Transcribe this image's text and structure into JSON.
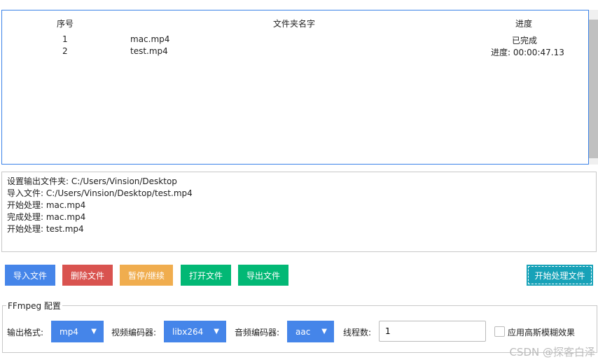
{
  "table": {
    "headers": [
      "序号",
      "文件夹名字",
      "进度"
    ],
    "rows": [
      {
        "index": "1",
        "name": "mac.mp4",
        "progress": "已完成"
      },
      {
        "index": "2",
        "name": "test.mp4",
        "progress": "进度: 00:00:47.13"
      }
    ]
  },
  "log": [
    "设置输出文件夹: C:/Users/Vinsion/Desktop",
    "导入文件: C:/Users/Vinsion/Desktop/test.mp4",
    "开始处理: mac.mp4",
    "完成处理: mac.mp4",
    "开始处理: test.mp4"
  ],
  "buttons": {
    "import": "导入文件",
    "delete": "删除文件",
    "pause": "暂停/继续",
    "open": "打开文件",
    "export": "导出文件",
    "start": "开始处理文件"
  },
  "config": {
    "title": "FFmpeg 配置",
    "format_label": "输出格式:",
    "format": "mp4",
    "vcodec_label": "视频编码器:",
    "vcodec": "libx264",
    "acodec_label": "音频编码器:",
    "acodec": "aac",
    "threads_label": "线程数:",
    "threads": "1",
    "blur_label": "应用高斯模糊效果",
    "blur_checked": false
  },
  "watermark": "CSDN @探客白泽"
}
